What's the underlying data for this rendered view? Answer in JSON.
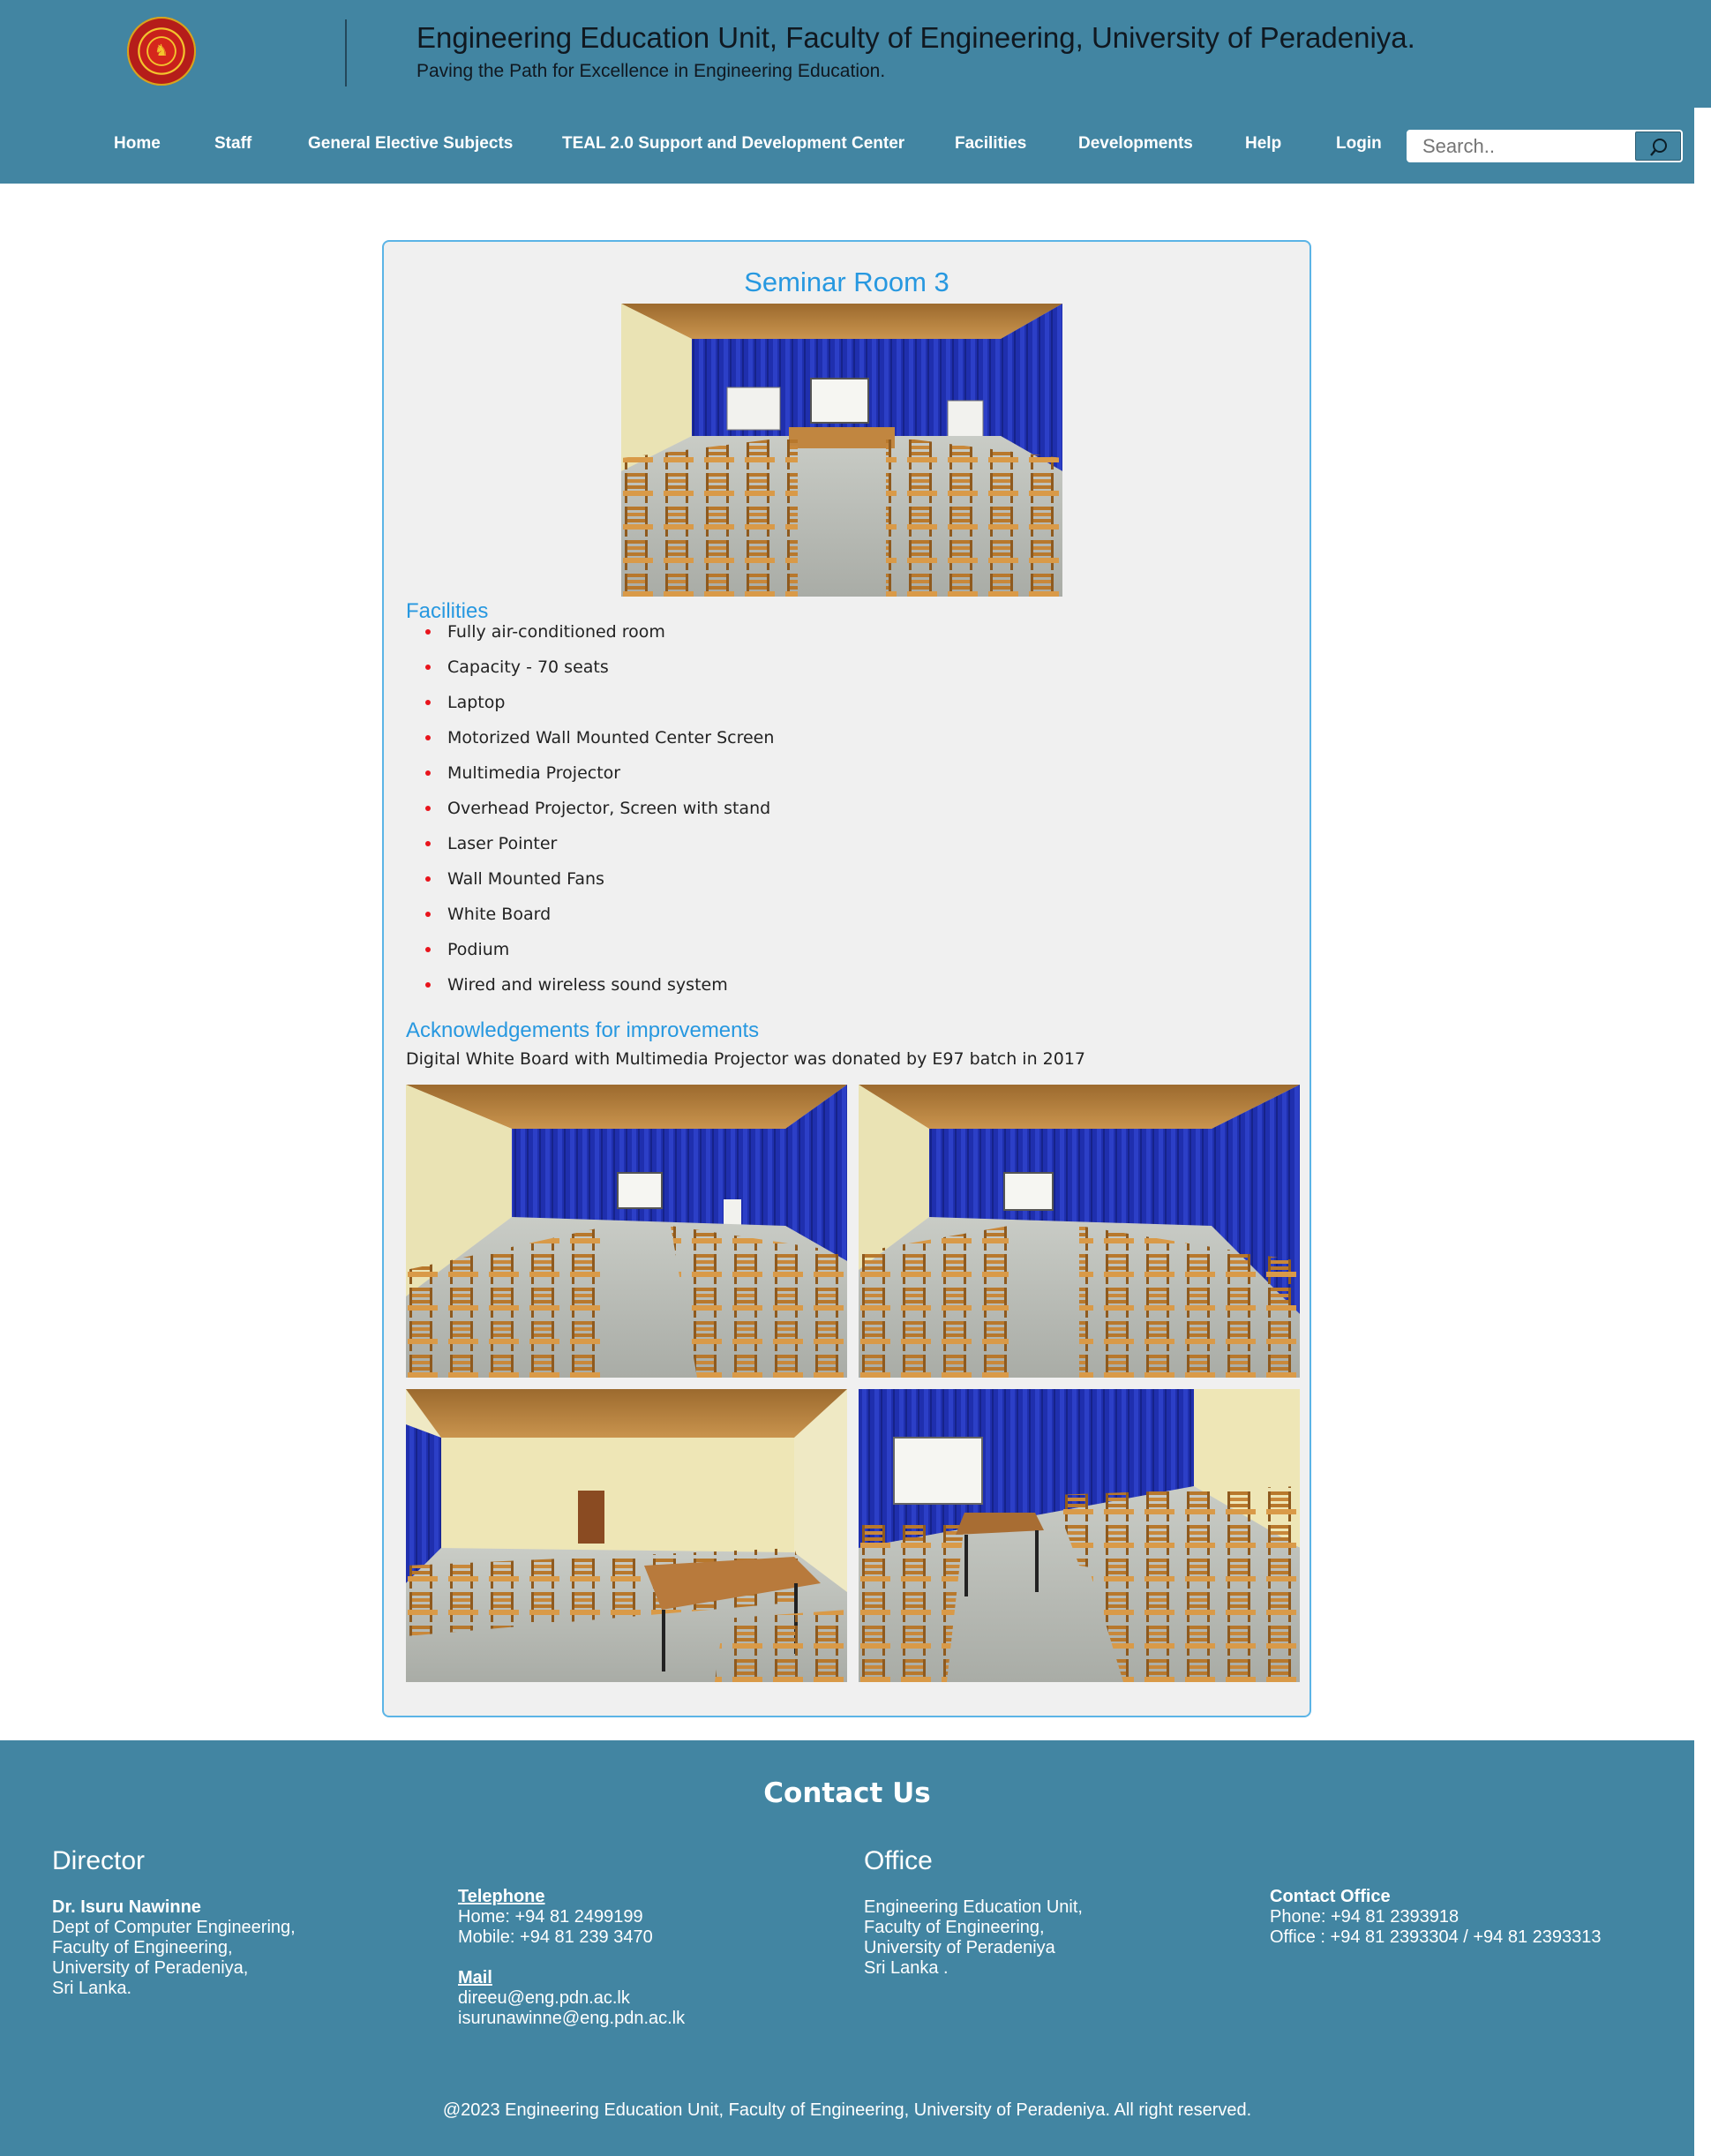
{
  "header": {
    "title": "Engineering Education Unit, Faculty of Engineering, University of Peradeniya.",
    "tagline": "Paving the Path for Excellence in Engineering Education."
  },
  "nav": {
    "items": [
      "Home",
      "Staff",
      "General Elective Subjects",
      "TEAL 2.0 Support and Development Center",
      "Facilities",
      "Developments",
      "Help",
      "Login"
    ]
  },
  "search": {
    "placeholder": "Search.."
  },
  "page": {
    "title": "Seminar Room 3",
    "facilities_heading": "Facilities",
    "facilities": [
      "Fully air-conditioned room",
      "Capacity - 70 seats",
      "Laptop",
      "Motorized Wall Mounted Center Screen",
      "Multimedia Projector",
      "Overhead Projector, Screen with stand",
      "Laser Pointer",
      "Wall Mounted Fans",
      "White Board",
      "Podium",
      "Wired and wireless sound system"
    ],
    "ack_heading": "Acknowledgements for improvements",
    "ack_text": "Digital White Board with Multimedia Projector was donated by E97 batch in 2017"
  },
  "footer": {
    "contact_title": "Contact Us",
    "director_heading": "Director",
    "director_name": "Dr. Isuru Nawinne",
    "director_lines": [
      "Dept of Computer Engineering,",
      "Faculty of Engineering,",
      "University of Peradeniya,",
      "Sri Lanka."
    ],
    "telephone_label": "Telephone",
    "telephone_lines": [
      "Home: +94 81 2499199",
      "Mobile: +94 81 239 3470"
    ],
    "mail_label": "Mail",
    "mail_lines": [
      "direeu@eng.pdn.ac.lk",
      "isurunawinne@eng.pdn.ac.lk"
    ],
    "office_heading": "Office",
    "office_lines": [
      "Engineering Education Unit,",
      "Faculty of Engineering,",
      "University of Peradeniya",
      "Sri Lanka ."
    ],
    "contact_office_label": "Contact Office",
    "contact_office_lines": [
      "Phone: +94 81 2393918",
      "Office : +94 81 2393304 / +94 81 2393313"
    ],
    "copyright": "@2023 Engineering Education Unit, Faculty of Engineering, University of Peradeniya. All right reserved."
  },
  "colors": {
    "brand": "#4285a2",
    "accent_heading": "#2798e0",
    "bullet": "#e8141c",
    "curtain": "#1f2fae"
  },
  "icons": [
    "university-logo",
    "search-icon"
  ]
}
